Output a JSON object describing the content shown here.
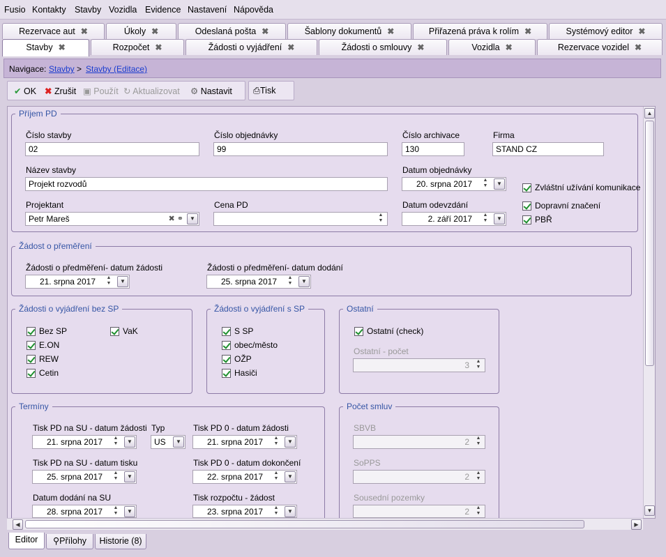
{
  "menu": [
    "Fusio",
    "Kontakty",
    "Stavby",
    "Vozidla",
    "Evidence",
    "Nastavení",
    "Nápověda"
  ],
  "tabs_row1": [
    "Rezervace aut",
    "Úkoly",
    "Odeslaná pošta",
    "Šablony dokumentů",
    "Přiřazená práva k rolím",
    "Systémový editor"
  ],
  "tabs_row2": [
    "Stavby",
    "Rozpočet",
    "Žádosti o vyjádření",
    "Žádosti o smlouvy",
    "Vozidla",
    "Rezervace vozidel"
  ],
  "nav": {
    "label": "Navigace:",
    "link1": "Stavby",
    "sep": ">",
    "link2": "Stavby (Editace)"
  },
  "toolbar": {
    "ok": "OK",
    "cancel": "Zrušit",
    "apply": "Použít",
    "refresh": "Aktualizovat",
    "settings": "Nastavit",
    "print": "Tisk"
  },
  "prijem": {
    "legend": "Příjem PD",
    "cislo_stavby_label": "Číslo stavby",
    "cislo_stavby": "02",
    "cislo_obj_label": "Číslo objednávky",
    "cislo_obj": "99",
    "cislo_arch_label": "Číslo archivace",
    "cislo_arch": "130",
    "firma_label": "Firma",
    "firma": "STAND CZ",
    "nazev_label": "Název stavby",
    "nazev": "Projekt rozvodů",
    "datum_obj_label": "Datum objednávky",
    "datum_obj": "20. srpna 2017",
    "projektant_label": "Projektant",
    "projektant": "Petr Mareš",
    "cena_label": "Cena PD",
    "cena": "",
    "datum_odev_label": "Datum odevzdání",
    "datum_odev": "2. září 2017",
    "cb1": "Zvláštní užívání komunikace",
    "cb2": "Dopravní značení",
    "cb3": "PBŘ"
  },
  "premereni": {
    "legend": "Žádost o přeměření",
    "l1": "Žádosti o předměření- datum žádosti",
    "v1": "21. srpna 2017",
    "l2": "Žádosti o předměření- datum dodání",
    "v2": "25. srpna 2017"
  },
  "bezsp": {
    "legend": "Žádosti o vyjádření bez SP",
    "items": [
      "Bez SP",
      "E.ON",
      "REW",
      "Cetin"
    ],
    "vak": "VaK"
  },
  "ssp": {
    "legend": "Žádosti o vyjádření s SP",
    "items": [
      "S SP",
      "obec/město",
      "OŽP",
      "Hasiči"
    ]
  },
  "ostatni": {
    "legend": "Ostatní",
    "check": "Ostatní (check)",
    "pocet_label": "Ostatní - počet",
    "pocet": "3"
  },
  "terminy": {
    "legend": "Termíny",
    "l1": "Tisk PD na SU - datum žádosti",
    "v1": "21. srpna 2017",
    "typ_label": "Typ",
    "typ": "US",
    "l2": "Tisk PD 0 - datum žádosti",
    "v2": "21. srpna 2017",
    "l3": "Tisk PD na SU - datum tisku",
    "v3": "25. srpna 2017",
    "l4": "Tisk PD 0 - datum dokončení",
    "v4": "22. srpna 2017",
    "l5": "Datum dodání na SU",
    "v5": "28. srpna 2017",
    "l6": "Tisk rozpočtu - žádost",
    "v6": "23. srpna 2017"
  },
  "smlouvy": {
    "legend": "Počet smluv",
    "l1": "SBVB",
    "v1": "2",
    "l2": "SoPPS",
    "v2": "2",
    "l3": "Sousední pozemky",
    "v3": "2"
  },
  "bottom_tabs": [
    "Editor",
    "Přílohy",
    "Historie (8)"
  ]
}
